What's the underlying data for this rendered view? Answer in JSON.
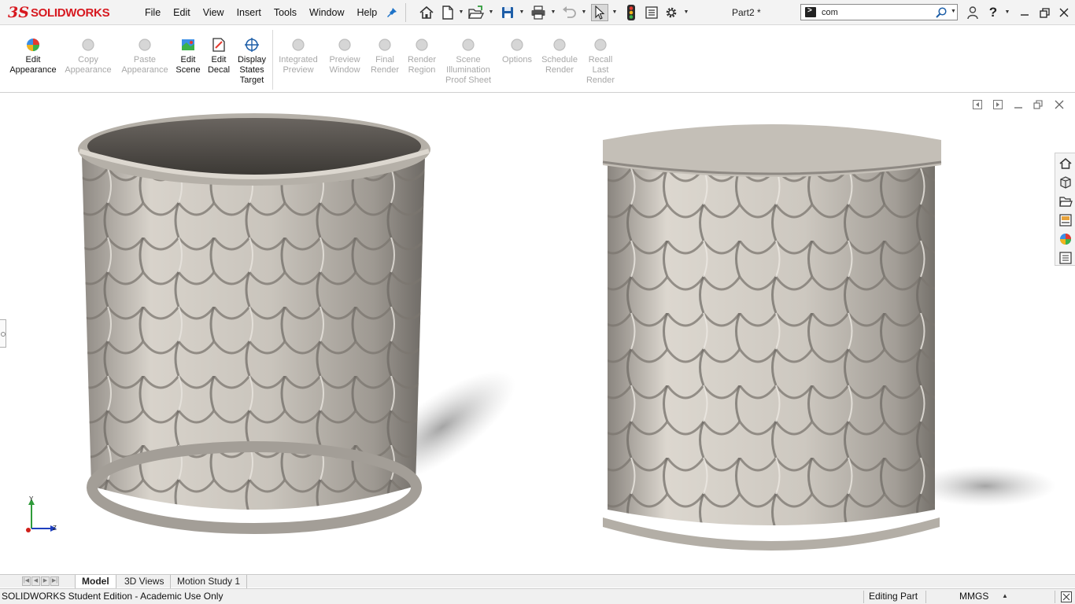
{
  "app": {
    "brand_ds": "3S",
    "brand_name": "SOLIDWORKS",
    "document_title": "Part2 *"
  },
  "menu": [
    "File",
    "Edit",
    "View",
    "Insert",
    "Tools",
    "Window",
    "Help"
  ],
  "search": {
    "value": "com"
  },
  "ribbon": {
    "buttons": [
      {
        "label": "Edit\nAppearance",
        "enabled": true,
        "icon": "appearance-icon"
      },
      {
        "label": "Copy\nAppearance",
        "enabled": false,
        "icon": "copy-appearance-icon"
      },
      {
        "label": "Paste\nAppearance",
        "enabled": false,
        "icon": "paste-appearance-icon"
      },
      {
        "label": "Edit\nScene",
        "enabled": true,
        "icon": "scene-icon"
      },
      {
        "label": "Edit\nDecal",
        "enabled": true,
        "icon": "decal-icon"
      },
      {
        "label": "Display\nStates\nTarget",
        "enabled": true,
        "icon": "display-states-icon"
      },
      {
        "label": "Integrated\nPreview",
        "enabled": false,
        "icon": "integrated-preview-icon"
      },
      {
        "label": "Preview\nWindow",
        "enabled": false,
        "icon": "preview-window-icon"
      },
      {
        "label": "Final\nRender",
        "enabled": false,
        "icon": "final-render-icon"
      },
      {
        "label": "Render\nRegion",
        "enabled": false,
        "icon": "render-region-icon"
      },
      {
        "label": "Scene\nIllumination\nProof Sheet",
        "enabled": false,
        "icon": "scene-illumination-icon"
      },
      {
        "label": "Options",
        "enabled": false,
        "icon": "options-icon"
      },
      {
        "label": "Schedule\nRender",
        "enabled": false,
        "icon": "schedule-render-icon"
      },
      {
        "label": "Recall\nLast\nRender",
        "enabled": false,
        "icon": "recall-last-render-icon"
      }
    ]
  },
  "tabs": {
    "model": "Model",
    "views_3d": "3D Views",
    "motion": "Motion Study 1"
  },
  "status": {
    "edition": "SOLIDWORKS Student Edition - Academic Use Only",
    "mode": "Editing Part",
    "units": "MMGS"
  },
  "triad": {
    "y": "Y",
    "z": "Z"
  },
  "colors": {
    "brand_red": "#d71920",
    "surface": "#cfcac3",
    "toolbar_bg": "#f3f3f3"
  }
}
